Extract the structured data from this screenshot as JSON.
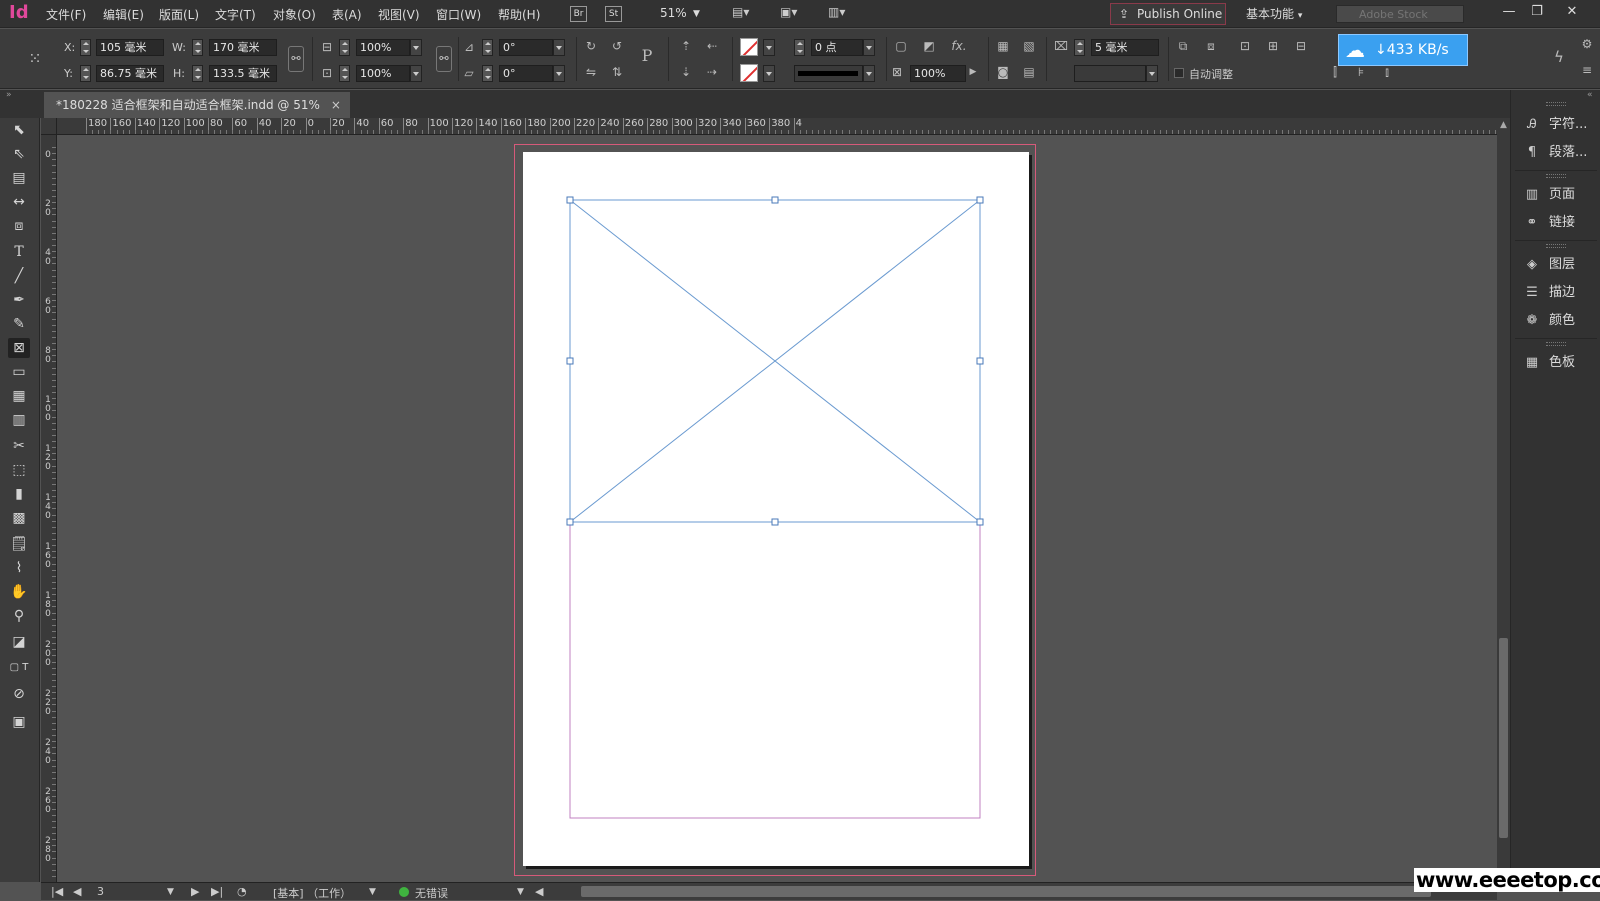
{
  "app": {
    "logo": "Id",
    "menus": [
      "文件(F)",
      "编辑(E)",
      "版面(L)",
      "文字(T)",
      "对象(O)",
      "表(A)",
      "视图(V)",
      "窗口(W)",
      "帮助(H)"
    ],
    "bridge_badge": "Br",
    "stock_badge": "St",
    "zoom": "51%",
    "publish_label": "Publish Online",
    "workspace_label": "基本功能",
    "stock_placeholder": "Adobe Stock"
  },
  "control": {
    "x_label": "X:",
    "x_value": "105 毫米",
    "y_label": "Y:",
    "y_value": "86.75 毫米",
    "w_label": "W:",
    "w_value": "170 毫米",
    "h_label": "H:",
    "h_value": "133.5 毫米",
    "scale_x": "100%",
    "scale_y": "100%",
    "rotate": "0°",
    "shear": "0°",
    "stroke_weight": "0 点",
    "opacity": "100%",
    "gap": "5 毫米",
    "auto_fit_label": "自动调整"
  },
  "speed_widget": {
    "text": "433 KB/s"
  },
  "document": {
    "tab_title": "*180228 适合框架和自动适合框架.indd @ 51%",
    "close_glyph": "×"
  },
  "hruler_labels": [
    "180",
    "160",
    "140",
    "120",
    "100",
    "80",
    "60",
    "40",
    "20",
    "0",
    "20",
    "40",
    "60",
    "80",
    "100",
    "120",
    "140",
    "160",
    "180",
    "200",
    "220",
    "240",
    "260",
    "280",
    "300",
    "320",
    "340",
    "360",
    "380",
    "4"
  ],
  "vruler_labels": [
    "0",
    "2 0",
    "4 0",
    "6 0",
    "8 0",
    "1 0 0",
    "1 2 0",
    "1 4 0",
    "1 6 0",
    "1 8 0",
    "2 0 0",
    "2 2 0",
    "2 4 0",
    "2 6 0",
    "2 8 0"
  ],
  "panels": {
    "items": [
      {
        "label": "字符...",
        "icon": "character-icon"
      },
      {
        "label": "段落...",
        "icon": "paragraph-icon"
      },
      {
        "label": "页面",
        "icon": "pages-icon"
      },
      {
        "label": "链接",
        "icon": "links-icon"
      },
      {
        "label": "图层",
        "icon": "layers-icon"
      },
      {
        "label": "描边",
        "icon": "stroke-icon"
      },
      {
        "label": "颜色",
        "icon": "color-icon"
      },
      {
        "label": "色板",
        "icon": "swatches-icon"
      }
    ]
  },
  "status": {
    "page_number": "3",
    "mode": "[基本] （工作）",
    "preflight": "无错误"
  },
  "watermark": "www.eeeetop.com",
  "colors": {
    "frame_stroke": "#6a9ad0",
    "margin_guide": "#c080c0",
    "bleed_guide": "#d65a7a",
    "accent": "#e0489b",
    "speed_widget": "#3aa0f0"
  }
}
